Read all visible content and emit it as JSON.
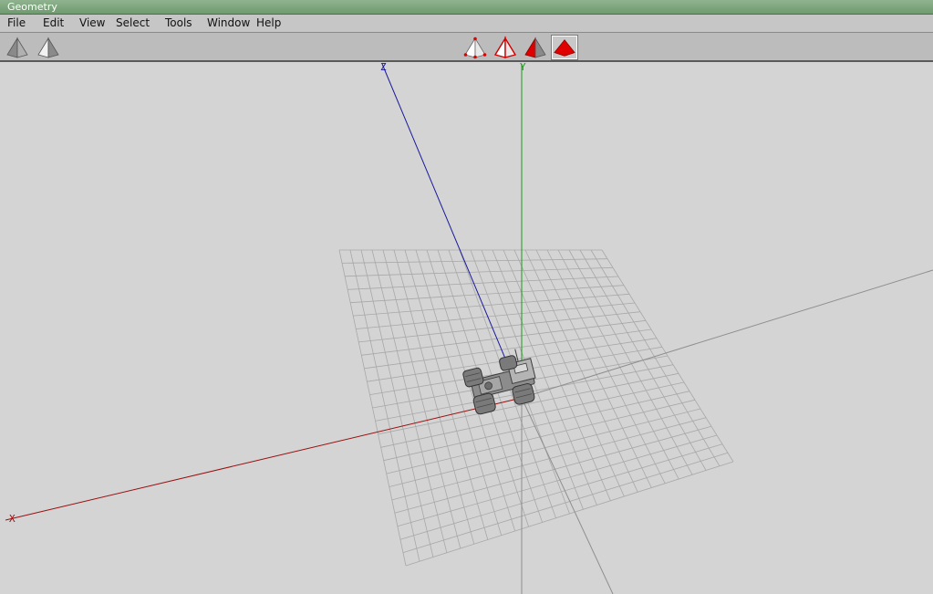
{
  "window": {
    "title": "Geometry"
  },
  "menu": {
    "items": [
      {
        "label": "File"
      },
      {
        "label": "Edit"
      },
      {
        "label": "View"
      },
      {
        "label": "Select"
      },
      {
        "label": "Tools"
      },
      {
        "label": "Window"
      },
      {
        "label": "Help"
      }
    ]
  },
  "toolbar": {
    "left_tools": [
      {
        "icon": "solid-pyramid-icon"
      },
      {
        "icon": "shaded-pyramid-icon"
      }
    ],
    "mode_tools": [
      {
        "icon": "vertex-mode-icon",
        "selected": false
      },
      {
        "icon": "edge-mode-icon",
        "selected": false
      },
      {
        "icon": "face-mode-icon",
        "selected": false
      },
      {
        "icon": "object-mode-icon",
        "selected": true
      }
    ]
  },
  "viewport": {
    "axes": {
      "x_label": "X",
      "y_label": "Y",
      "z_label": "Z",
      "x_color": "#9a1010",
      "y_color": "#1a9a1a",
      "z_color": "#1a1a9a"
    },
    "grid_color": "#a8a8a8",
    "background": "#d4d4d4",
    "model": "truck-model"
  }
}
